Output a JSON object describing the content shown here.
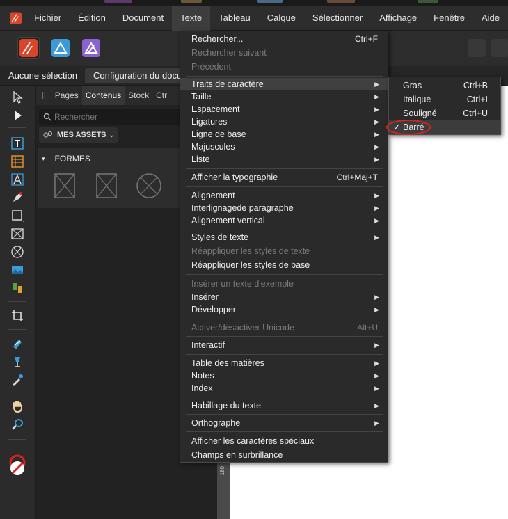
{
  "colors": {
    "accent_red": "#e0201c",
    "app_bg": "#2b2b2b",
    "menu_bg": "#2a2a2a",
    "highlight": "#404040",
    "disabled_text": "#7a7a7a",
    "designer_icon": "#d9452a",
    "photo_icon": "#3a9bd8",
    "publisher_icon": "#8a63d2"
  },
  "menubar": {
    "logo_icon": "affinity-publisher-logo",
    "items": [
      "Fichier",
      "Édition",
      "Document",
      "Texte",
      "Tableau",
      "Calque",
      "Sélectionner",
      "Affichage",
      "Fenêtre",
      "Aide"
    ],
    "active": "Texte"
  },
  "context_bar": {
    "selection_label": "Aucune sélection",
    "config_button": "Configuration du document"
  },
  "panel": {
    "tabs": [
      "Pages",
      "Contenus",
      "Stock",
      "Ctr"
    ],
    "active_tab": "Contenus",
    "search_placeholder": "Rechercher",
    "assets_label": "MES ASSETS",
    "section_title": "FORMES"
  },
  "ruler": {
    "label": "180"
  },
  "text_menu": {
    "items": [
      {
        "label": "Rechercher...",
        "shortcut": "Ctrl+F",
        "disabled": false,
        "submenu": false
      },
      {
        "label": "Rechercher suivant",
        "shortcut": "",
        "disabled": true,
        "submenu": false
      },
      {
        "label": "Précédent",
        "shortcut": "",
        "disabled": true,
        "submenu": false
      },
      {
        "label": "Traits de caractère",
        "shortcut": "",
        "disabled": false,
        "submenu": true,
        "highlighted": true
      },
      {
        "label": "Taille",
        "shortcut": "",
        "disabled": false,
        "submenu": true
      },
      {
        "label": "Espacement",
        "shortcut": "",
        "disabled": false,
        "submenu": true
      },
      {
        "label": "Ligatures",
        "shortcut": "",
        "disabled": false,
        "submenu": true
      },
      {
        "label": "Ligne de base",
        "shortcut": "",
        "disabled": false,
        "submenu": true
      },
      {
        "label": "Majuscules",
        "shortcut": "",
        "disabled": false,
        "submenu": true
      },
      {
        "label": "Liste",
        "shortcut": "",
        "disabled": false,
        "submenu": true
      },
      {
        "label": "Afficher la typographie",
        "shortcut": "Ctrl+Maj+T",
        "disabled": false,
        "submenu": false
      },
      {
        "label": "Alignement",
        "shortcut": "",
        "disabled": false,
        "submenu": true
      },
      {
        "label": "Interlignagede paragraphe",
        "shortcut": "",
        "disabled": false,
        "submenu": true
      },
      {
        "label": "Alignement vertical",
        "shortcut": "",
        "disabled": false,
        "submenu": true
      },
      {
        "label": "Styles de texte",
        "shortcut": "",
        "disabled": false,
        "submenu": true
      },
      {
        "label": "Réappliquer les styles de texte",
        "shortcut": "",
        "disabled": true,
        "submenu": false
      },
      {
        "label": "Réappliquer les styles de base",
        "shortcut": "",
        "disabled": false,
        "submenu": false
      },
      {
        "label": "Insérer un texte d'exemple",
        "shortcut": "",
        "disabled": true,
        "submenu": false
      },
      {
        "label": "Insérer",
        "shortcut": "",
        "disabled": false,
        "submenu": true
      },
      {
        "label": "Développer",
        "shortcut": "",
        "disabled": false,
        "submenu": true
      },
      {
        "label": "Activer/désactiver Unicode",
        "shortcut": "Alt+U",
        "disabled": true,
        "submenu": false
      },
      {
        "label": "Interactif",
        "shortcut": "",
        "disabled": false,
        "submenu": true
      },
      {
        "label": "Table des matières",
        "shortcut": "",
        "disabled": false,
        "submenu": true
      },
      {
        "label": "Notes",
        "shortcut": "",
        "disabled": false,
        "submenu": true
      },
      {
        "label": "Index",
        "shortcut": "",
        "disabled": false,
        "submenu": true
      },
      {
        "label": "Habillage du texte",
        "shortcut": "",
        "disabled": false,
        "submenu": true
      },
      {
        "label": "Orthographe",
        "shortcut": "",
        "disabled": false,
        "submenu": true
      },
      {
        "label": "Afficher les caractères spéciaux",
        "shortcut": "",
        "disabled": false,
        "submenu": false
      },
      {
        "label": "Champs en surbrillance",
        "shortcut": "",
        "disabled": false,
        "submenu": false
      }
    ]
  },
  "char_traits_submenu": {
    "items": [
      {
        "label": "Gras",
        "shortcut": "Ctrl+B",
        "checked": false
      },
      {
        "label": "Italique",
        "shortcut": "Ctrl+I",
        "checked": false
      },
      {
        "label": "Souligné",
        "shortcut": "Ctrl+U",
        "checked": false
      },
      {
        "label": "Barré",
        "shortcut": "",
        "checked": true
      }
    ],
    "check_glyph": "✓"
  },
  "tools": [
    "move-icon",
    "node-icon",
    "frame-text-icon",
    "table-icon",
    "artistic-text-icon",
    "pen-icon",
    "rectangle-icon",
    "picture-frame-icon",
    "ellipse-frame-icon",
    "place-image-icon",
    "vector-crop-icon",
    "crop-icon",
    "fill-icon",
    "transparency-icon",
    "color-picker-icon",
    "hand-icon",
    "zoom-icon",
    "color-swatch-icon"
  ]
}
